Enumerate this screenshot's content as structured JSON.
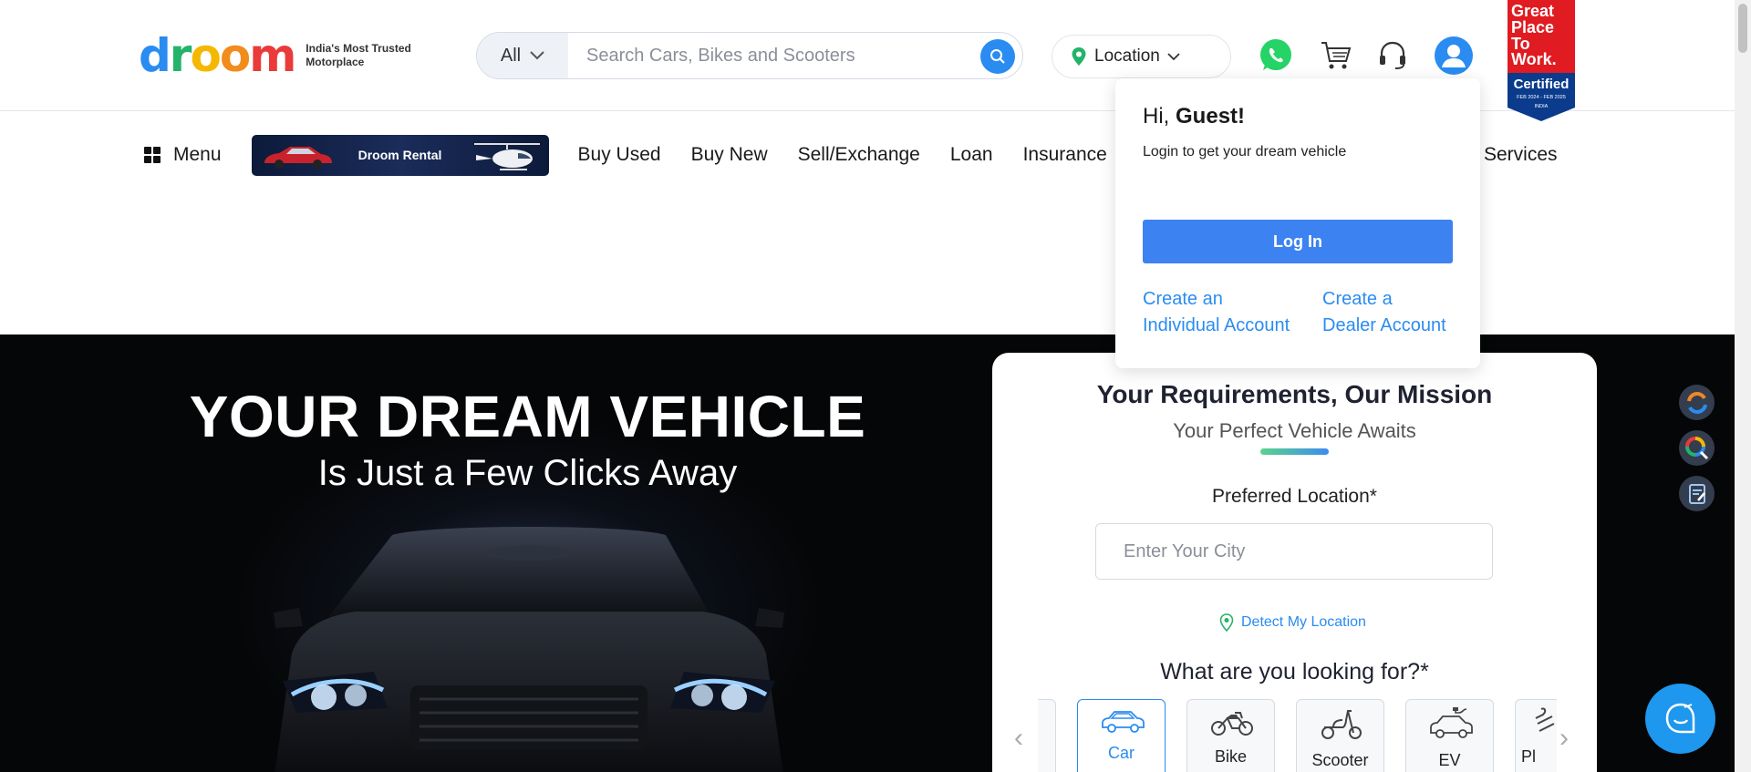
{
  "header": {
    "logo": {
      "letters": [
        "d",
        "r",
        "o",
        "o",
        "m"
      ],
      "tagline": "India's Most Trusted Motorplace"
    },
    "search": {
      "category": "All",
      "placeholder": "Search Cars, Bikes and Scooters"
    },
    "location": {
      "label": "Location"
    },
    "badge": {
      "lines": [
        "Great",
        "Place",
        "To",
        "Work."
      ],
      "certified": "Certified",
      "dates": "FEB 2024 - FEB 2025",
      "country": "INDIA"
    },
    "icons": [
      "whatsapp-icon",
      "cart-icon",
      "headset-icon",
      "user-icon"
    ]
  },
  "nav": {
    "menu_label": "Menu",
    "rental_label": "Droom Rental",
    "links": [
      "Buy Used",
      "Buy New",
      "Sell/Exchange",
      "Loan",
      "Insurance"
    ],
    "services": "Services"
  },
  "popup": {
    "greeting": "Hi,",
    "name": "Guest!",
    "subtitle": "Login to get your dream vehicle",
    "login": "Log In",
    "individual_line1": "Create an",
    "individual_line2": "Individual Account",
    "dealer_line1": "Create a",
    "dealer_line2": "Dealer Account"
  },
  "hero": {
    "title": "YOUR DREAM VEHICLE",
    "subtitle": "Is Just a Few Clicks Away"
  },
  "form": {
    "title": "Your Requirements, Our Mission",
    "subtitle": "Your Perfect Vehicle Awaits",
    "location_label": "Preferred Location*",
    "city_placeholder": "Enter Your City",
    "detect": "Detect My Location",
    "question": "What are you looking for?*",
    "vehicles": [
      {
        "label": "Car",
        "selected": true
      },
      {
        "label": "Bike",
        "selected": false
      },
      {
        "label": "Scooter",
        "selected": false
      },
      {
        "label": "EV",
        "selected": false
      },
      {
        "label": "Pl",
        "selected": false
      }
    ]
  },
  "colors": {
    "accent": "#2a8cf0",
    "login_button": "#3d82f1",
    "hero_bg": "#050607"
  }
}
